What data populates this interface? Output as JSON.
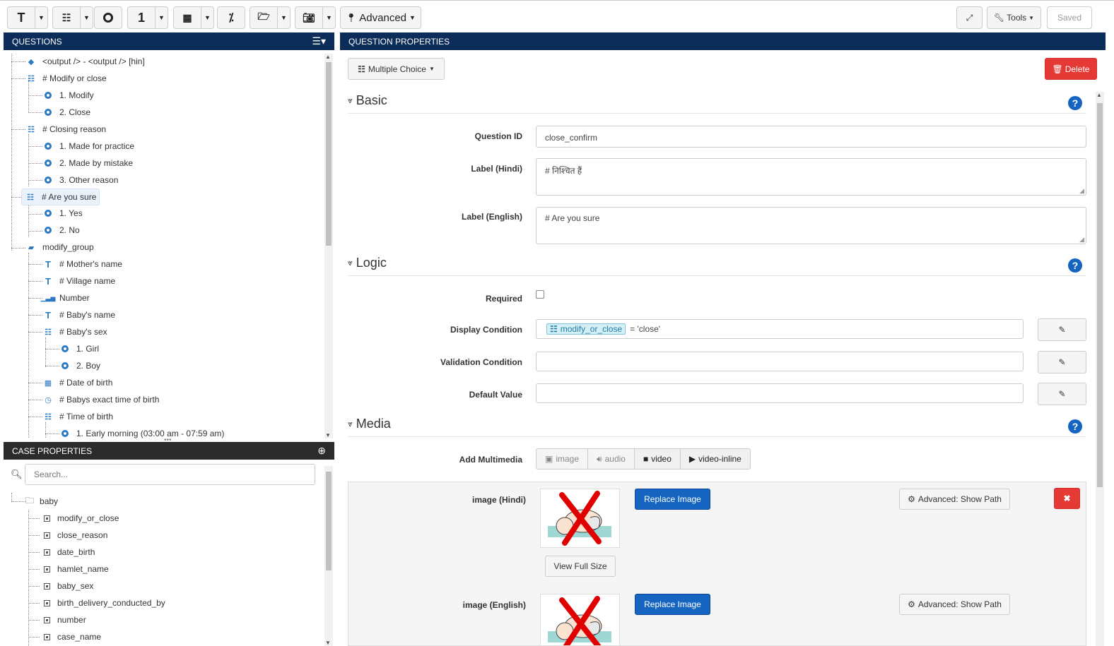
{
  "toolbar": {
    "text_icon": "T",
    "number_icon": "1",
    "advanced_label": "Advanced",
    "tools_label": "Tools",
    "saved_label": "Saved"
  },
  "questions_panel": {
    "title": "QUESTIONS",
    "items": [
      {
        "label": "<output /> - <output /> [hin]",
        "icon": "tag-icon"
      },
      {
        "label": "# Modify or close",
        "icon": "list-icon"
      },
      {
        "label": "1. Modify",
        "icon": "radio-icon"
      },
      {
        "label": "2. Close",
        "icon": "radio-icon"
      },
      {
        "label": "# Closing reason",
        "icon": "list-icon"
      },
      {
        "label": "1. Made for practice",
        "icon": "radio-icon"
      },
      {
        "label": "2. Made by mistake",
        "icon": "radio-icon"
      },
      {
        "label": "3. Other reason",
        "icon": "radio-icon"
      },
      {
        "label": "# Are you sure",
        "icon": "list-icon"
      },
      {
        "label": "1. Yes",
        "icon": "radio-icon"
      },
      {
        "label": "2. No",
        "icon": "radio-icon"
      },
      {
        "label": "modify_group",
        "icon": "folder-icon"
      },
      {
        "label": "# Mother's name",
        "icon": "text-icon"
      },
      {
        "label": "# Village name",
        "icon": "text-icon"
      },
      {
        "label": "Number",
        "icon": "signal-icon"
      },
      {
        "label": "# Baby's name",
        "icon": "text-icon"
      },
      {
        "label": "# Baby's sex",
        "icon": "list-icon"
      },
      {
        "label": "1. Girl",
        "icon": "radio-icon"
      },
      {
        "label": "2. Boy",
        "icon": "radio-icon"
      },
      {
        "label": "# Date of birth",
        "icon": "calendar-icon"
      },
      {
        "label": "# Babys exact time of birth",
        "icon": "clock-icon"
      },
      {
        "label": "# Time of birth",
        "icon": "list-icon"
      },
      {
        "label": "1. Early morning (03:00 am - 07:59 am)",
        "icon": "radio-icon"
      }
    ]
  },
  "case_panel": {
    "title": "CASE PROPERTIES",
    "search_placeholder": "Search...",
    "root": "baby",
    "items": [
      "modify_or_close",
      "close_reason",
      "date_birth",
      "hamlet_name",
      "baby_sex",
      "birth_delivery_conducted_by",
      "number",
      "case_name"
    ]
  },
  "properties": {
    "title": "QUESTION PROPERTIES",
    "type_label": "Multiple Choice",
    "delete_label": "Delete",
    "basic": {
      "title": "Basic",
      "question_id_label": "Question ID",
      "question_id_value": "close_confirm",
      "label_hindi_label": "Label (Hindi)",
      "label_hindi_value": "# निश्चित हैं",
      "label_english_label": "Label (English)",
      "label_english_value": "# Are you sure"
    },
    "logic": {
      "title": "Logic",
      "required_label": "Required",
      "display_condition_label": "Display Condition",
      "display_condition_tag": "modify_or_close",
      "display_condition_rest": "= 'close'",
      "validation_condition_label": "Validation Condition",
      "default_value_label": "Default Value"
    },
    "media": {
      "title": "Media",
      "add_multimedia_label": "Add Multimedia",
      "buttons": [
        "image",
        "audio",
        "video",
        "video-inline"
      ],
      "image_hindi_label": "image (Hindi)",
      "image_english_label": "image (English)",
      "replace_image_label": "Replace Image",
      "view_full_size_label": "View Full Size",
      "advanced_show_path_label": "Advanced: Show Path"
    }
  }
}
